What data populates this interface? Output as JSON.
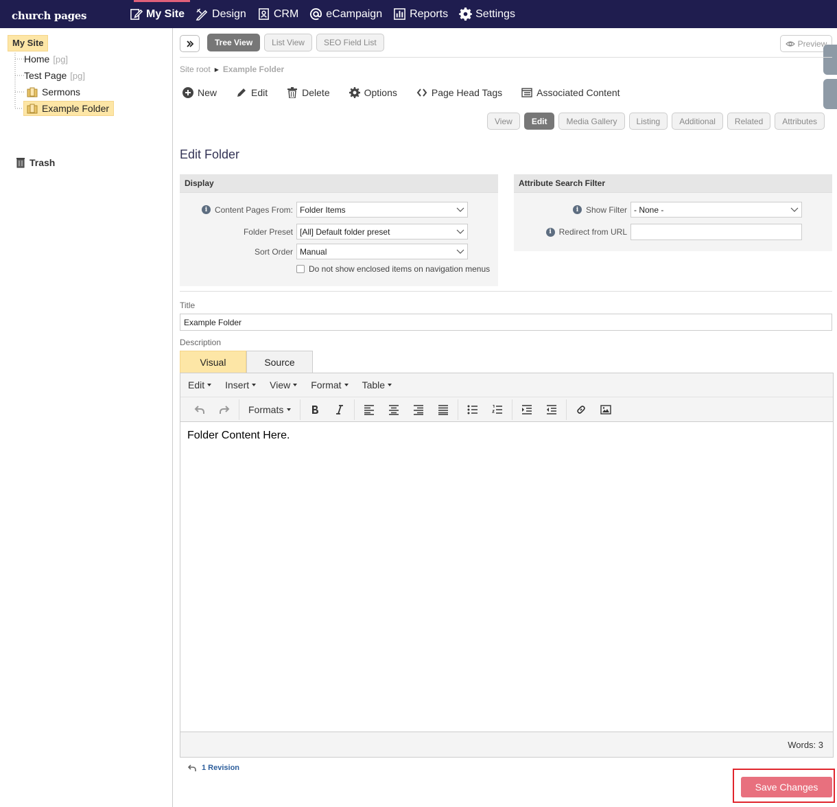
{
  "app": {
    "logo": "church pages"
  },
  "topnav": {
    "items": [
      {
        "label": "My Site",
        "icon": "edit-page-icon",
        "active": true
      },
      {
        "label": "Design",
        "icon": "pencil-ruler-icon"
      },
      {
        "label": "CRM",
        "icon": "contact-card-icon"
      },
      {
        "label": "eCampaign",
        "icon": "at-sign-icon"
      },
      {
        "label": "Reports",
        "icon": "bar-chart-icon"
      },
      {
        "label": "Settings",
        "icon": "gear-icon"
      }
    ]
  },
  "sidebar": {
    "root": "My Site",
    "items": [
      {
        "label": "Home",
        "tag": "[pg]"
      },
      {
        "label": "Test Page",
        "tag": "[pg]"
      },
      {
        "label": "Sermons"
      },
      {
        "label": "Example Folder",
        "selected": true
      }
    ],
    "trash": "Trash"
  },
  "viewtabs": [
    "Tree View",
    "List View",
    "SEO Field List"
  ],
  "preview": "Preview",
  "breadcrumb": {
    "root": "Site root",
    "current": "Example Folder"
  },
  "actions": [
    "New",
    "Edit",
    "Delete",
    "Options",
    "Page Head Tags",
    "Associated Content"
  ],
  "edittabs": [
    "View",
    "Edit",
    "Media Gallery",
    "Listing",
    "Additional",
    "Related",
    "Attributes"
  ],
  "page_title": "Edit Folder",
  "display_panel": {
    "heading": "Display",
    "content_pages_from": {
      "label": "Content Pages From:",
      "value": "Folder Items"
    },
    "folder_preset": {
      "label": "Folder Preset",
      "value": "[All] Default folder preset"
    },
    "sort_order": {
      "label": "Sort Order",
      "value": "Manual"
    },
    "nav_checkbox": "Do not show enclosed items on navigation menus"
  },
  "filter_panel": {
    "heading": "Attribute Search Filter",
    "show_filter": {
      "label": "Show Filter",
      "value": "- None -"
    },
    "redirect": {
      "label": "Redirect from URL",
      "value": ""
    }
  },
  "title_field": {
    "label": "Title",
    "value": "Example Folder"
  },
  "description": {
    "label": "Description",
    "tabs": [
      "Visual",
      "Source"
    ],
    "menus": [
      "Edit",
      "Insert",
      "View",
      "Format",
      "Table"
    ],
    "formats": "Formats",
    "content": "Folder Content Here.",
    "words": "Words: 3"
  },
  "revision": "1 Revision",
  "save": "Save Changes",
  "colors": {
    "nav_bg": "#1f1d4f",
    "highlight": "#fde6a6",
    "save": "#e8707e",
    "accent": "#e0607a"
  }
}
